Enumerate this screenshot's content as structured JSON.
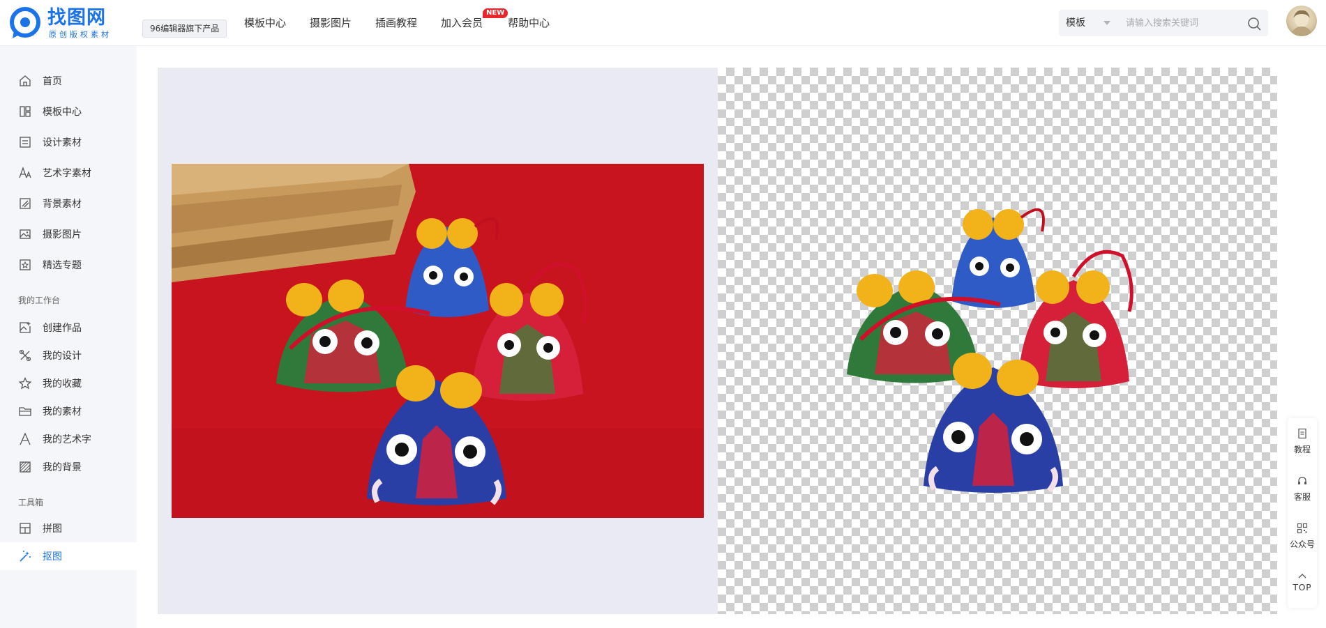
{
  "header": {
    "logo_title": "找图网",
    "logo_subtitle": "原创版权素材",
    "editor_badge": "96编辑器旗下产品",
    "nav": [
      {
        "label": "模板中心"
      },
      {
        "label": "摄影图片"
      },
      {
        "label": "插画教程"
      },
      {
        "label": "加入会员",
        "badge": "NEW"
      },
      {
        "label": "帮助中心"
      }
    ],
    "search": {
      "category": "模板",
      "placeholder": "请输入搜索关键词"
    }
  },
  "sidebar": {
    "items": [
      {
        "label": "首页",
        "icon": "home-icon"
      },
      {
        "label": "模板中心",
        "icon": "template-icon"
      },
      {
        "label": "设计素材",
        "icon": "design-material-icon"
      },
      {
        "label": "艺术字素材",
        "icon": "art-text-icon"
      },
      {
        "label": "背景素材",
        "icon": "background-icon"
      },
      {
        "label": "摄影图片",
        "icon": "photo-icon"
      },
      {
        "label": "精选专题",
        "icon": "topic-icon"
      }
    ],
    "group_workspace": "我的工作台",
    "workspace_items": [
      {
        "label": "创建作品",
        "icon": "create-icon"
      },
      {
        "label": "我的设计",
        "icon": "my-design-icon"
      },
      {
        "label": "我的收藏",
        "icon": "star-icon"
      },
      {
        "label": "我的素材",
        "icon": "folder-icon"
      },
      {
        "label": "我的艺术字",
        "icon": "letter-a-icon"
      },
      {
        "label": "我的背景",
        "icon": "stripes-icon"
      }
    ],
    "group_tools": "工具箱",
    "tool_items": [
      {
        "label": "拼图",
        "icon": "collage-icon"
      },
      {
        "label": "抠图",
        "icon": "magic-wand-icon",
        "active": true
      }
    ]
  },
  "float_tools": [
    {
      "label": "教程",
      "icon": "document-icon"
    },
    {
      "label": "客服",
      "icon": "headset-icon"
    },
    {
      "label": "公众号",
      "icon": "qrcode-icon"
    },
    {
      "label": "TOP",
      "icon": "arrow-up-icon"
    }
  ],
  "colors": {
    "brand": "#1a73e8",
    "badge_red": "#e9262b",
    "photo_bg": "#c8141f",
    "sachet_yellow": "#f2b21a"
  }
}
